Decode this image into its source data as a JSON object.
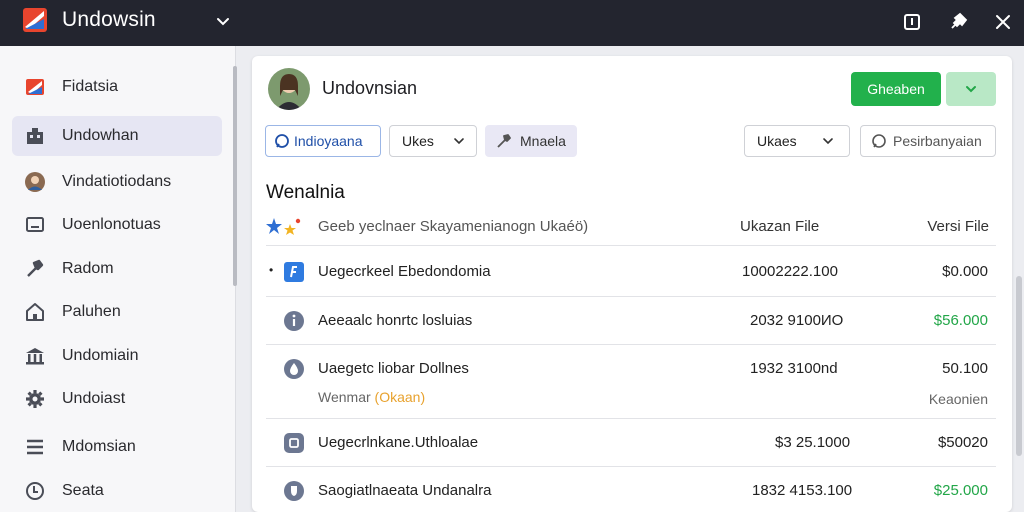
{
  "app": {
    "title": "Undowsin"
  },
  "sidebar": {
    "items": [
      {
        "label": "Fidatsia",
        "icon": "flag-icon"
      },
      {
        "label": "Undowhan",
        "icon": "building-icon",
        "active": true
      },
      {
        "label": "Vindatiotiodans",
        "icon": "user-avatar-icon"
      },
      {
        "label": "Uoenlonotuas",
        "icon": "monitor-icon"
      },
      {
        "label": "Radom",
        "icon": "tools-icon"
      },
      {
        "label": "Paluhen",
        "icon": "home-icon"
      },
      {
        "label": "Undomiain",
        "icon": "bank-icon"
      },
      {
        "label": "Undoiast",
        "icon": "gear-icon"
      },
      {
        "label": "Mdomsian",
        "icon": "menu-icon"
      },
      {
        "label": "Seata",
        "icon": "clock-icon"
      }
    ]
  },
  "header": {
    "title": "Undovnsian",
    "primary_label": "Gheaben"
  },
  "toolbar": {
    "filter_label": "Indioyaana",
    "uk_label": "Ukes",
    "edit_label": "Mnaela",
    "sort_label": "Ukaes",
    "search_label": "Pesirbanyaian"
  },
  "list": {
    "title": "Wenalnia",
    "columns": {
      "name": "Geeb yeclnaer Skayamenianogn Ukaéö)",
      "size": "Ukazan File",
      "version": "Versi File"
    },
    "rows": [
      {
        "name": "Uegecrkeel Ebedondomia",
        "size": "10002222.100",
        "price": "$0.000",
        "icon": "app-blue-icon",
        "bullet": "•"
      },
      {
        "name": "Aeeaalc honrtc losluias",
        "size": "2032 9100ИО",
        "price": "$56.000",
        "price_green": true,
        "icon": "info-icon"
      },
      {
        "name": "Uaegetc liobar Dollnes",
        "size": "1932 3100nd",
        "price": "50.100",
        "sub_left": "Wenmar",
        "sub_warn": "(Okaan)",
        "sub_right": "Keaonien",
        "icon": "drop-icon"
      },
      {
        "name": "Uegecrlnkane.Uthloalae",
        "size": "$3 25.1000",
        "price": "$50020",
        "icon": "chip-icon"
      },
      {
        "name": "Saogiatlnaeata Undanalra",
        "size": "1832 4153.100",
        "price": "$25.000",
        "price_green": true,
        "icon": "shield-icon"
      }
    ]
  }
}
